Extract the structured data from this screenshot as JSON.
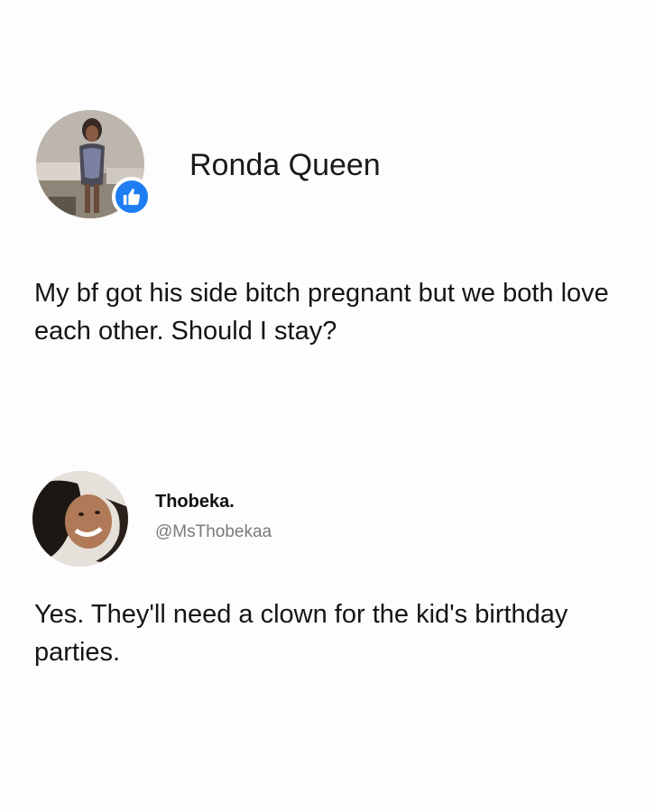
{
  "post": {
    "author_name": "Ronda Queen",
    "badge_icon": "thumbs-up-icon",
    "badge_color": "#1e7df2",
    "text": "My bf got his side bitch pregnant but we both love each other. Should I stay?"
  },
  "reply": {
    "display_name": "Thobeka.",
    "handle": "@MsThobekaa",
    "text": "Yes. They'll need a clown for the kid's birthday parties."
  }
}
